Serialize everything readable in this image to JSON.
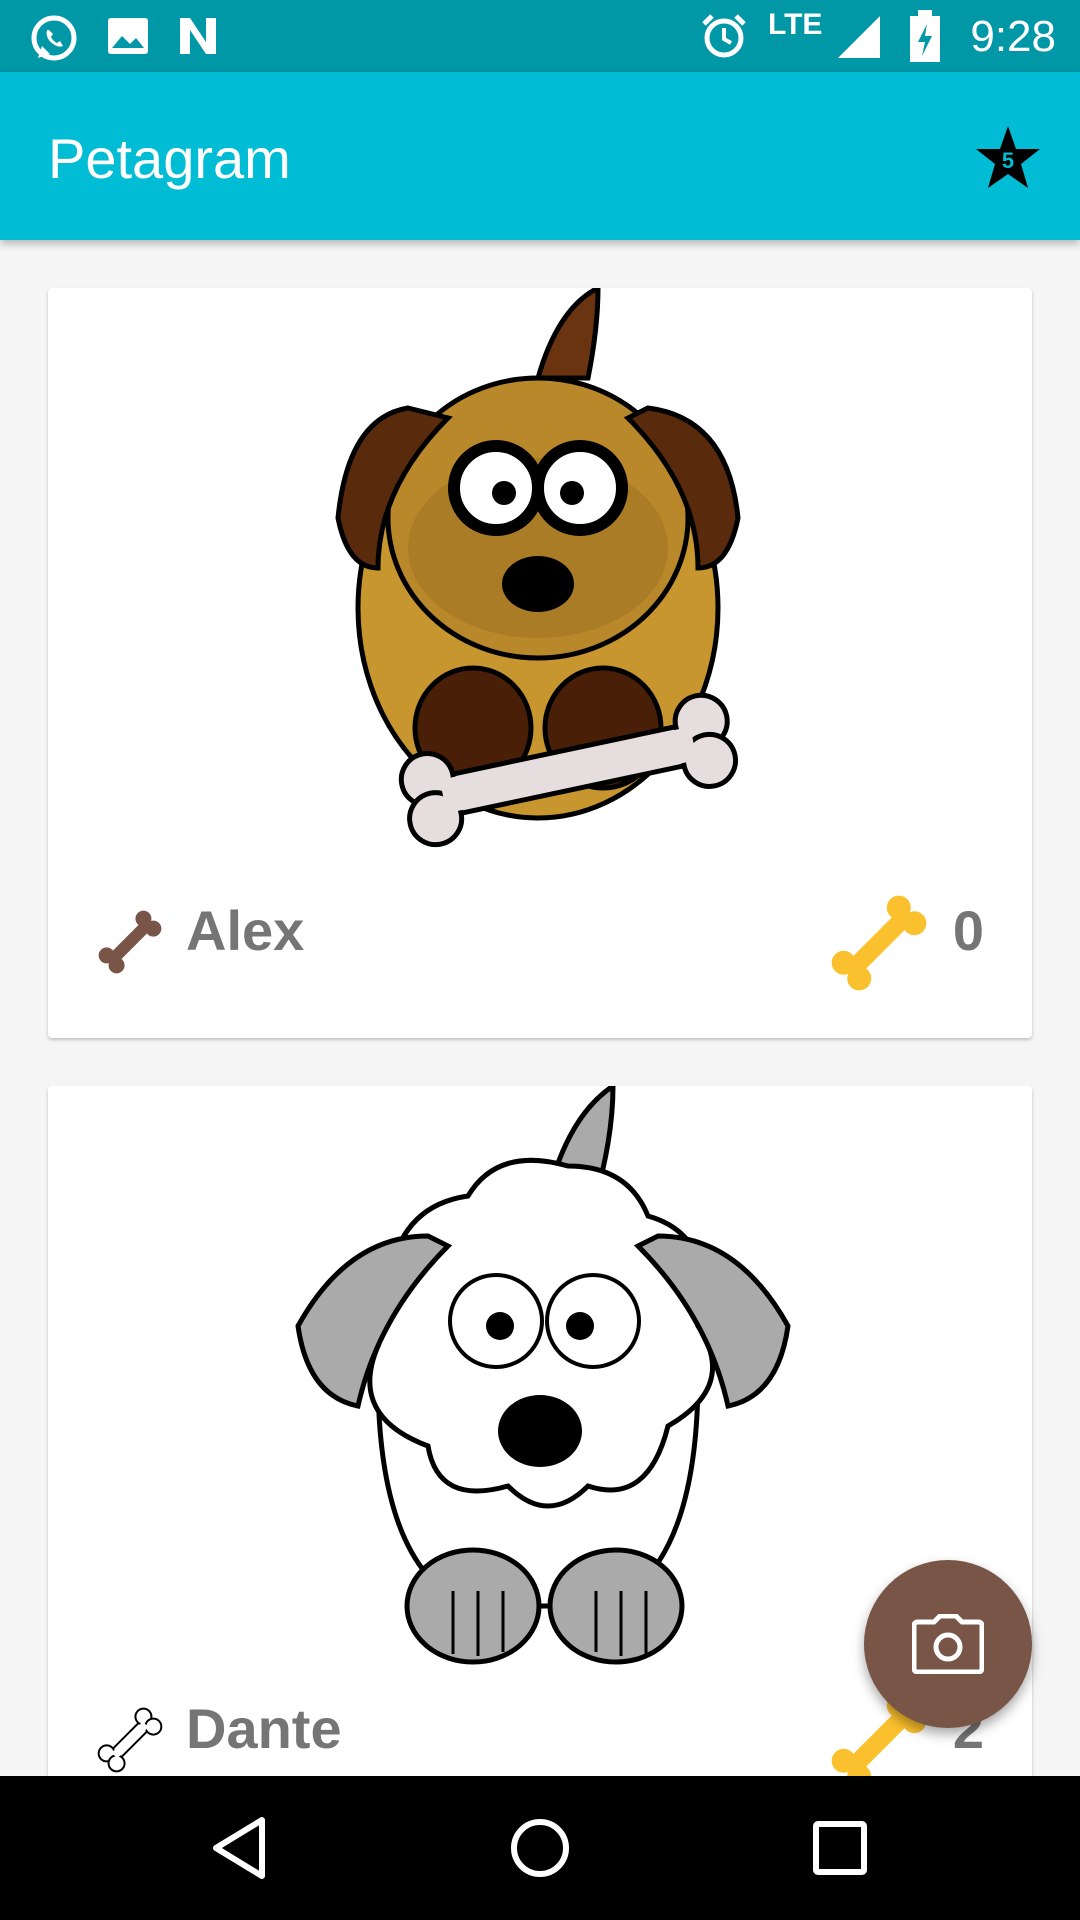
{
  "status_bar": {
    "time": "9:28",
    "network": "LTE",
    "left_icons": [
      "whatsapp-icon",
      "image-icon",
      "n-logo-icon"
    ],
    "right_icons": [
      "alarm-icon",
      "signal-icon",
      "battery-icon"
    ]
  },
  "app_bar": {
    "title": "Petagram",
    "rating_badge": "5",
    "colors": {
      "primary": "#00bcd4",
      "primary_dark": "#0097a7"
    }
  },
  "pets": [
    {
      "name": "Alex",
      "likes": "0",
      "name_icon": "bone-brown-icon",
      "likes_icon": "bone-yellow-icon"
    },
    {
      "name": "Dante",
      "likes": "2",
      "name_icon": "bone-outline-icon",
      "likes_icon": "bone-yellow-icon"
    }
  ],
  "fab": {
    "icon": "camera-icon",
    "color": "#795548"
  },
  "nav_bar": {
    "buttons": [
      "back-icon",
      "home-icon",
      "recents-icon"
    ]
  }
}
